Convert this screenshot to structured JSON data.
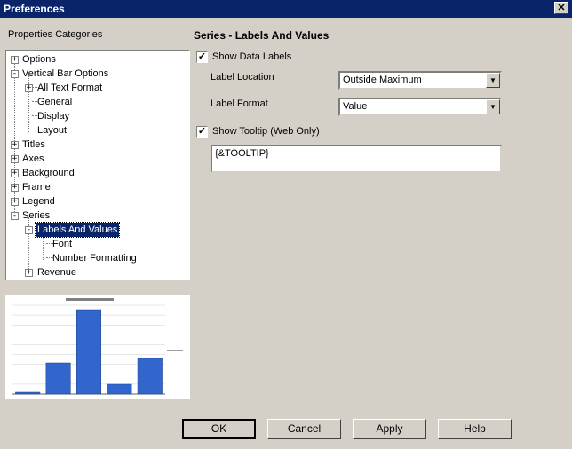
{
  "window": {
    "title": "Preferences",
    "close_glyph": "✕"
  },
  "left": {
    "heading": "Properties Categories",
    "tree": [
      {
        "label": "Options",
        "sign": "+"
      },
      {
        "label": "Vertical Bar Options",
        "sign": "-"
      },
      {
        "label": "All Text Format",
        "sign": "+"
      },
      {
        "label": "General"
      },
      {
        "label": "Display"
      },
      {
        "label": "Layout"
      },
      {
        "label": "Titles",
        "sign": "+"
      },
      {
        "label": "Axes",
        "sign": "+"
      },
      {
        "label": "Background",
        "sign": "+"
      },
      {
        "label": "Frame",
        "sign": "+"
      },
      {
        "label": "Legend",
        "sign": "+"
      },
      {
        "label": "Series",
        "sign": "-"
      },
      {
        "label": "Labels And Values",
        "sign": "-",
        "selected": true
      },
      {
        "label": "Font"
      },
      {
        "label": "Number Formatting"
      },
      {
        "label": "Revenue",
        "sign": "+"
      }
    ]
  },
  "right": {
    "heading": "Series - Labels And Values",
    "show_data_labels": {
      "label": "Show Data Labels",
      "checked": true
    },
    "label_location": {
      "label": "Label Location",
      "value": "Outside Maximum"
    },
    "label_format": {
      "label": "Label Format",
      "value": "Value"
    },
    "show_tooltip": {
      "label": "Show Tooltip (Web Only)",
      "checked": true
    },
    "tooltip_text": "{&TOOLTIP}"
  },
  "preview_chart": {
    "type": "bar",
    "values": [
      2,
      35,
      95,
      11,
      40
    ],
    "ylim": [
      0,
      100
    ],
    "bar_color": "#3366cc"
  },
  "buttons": {
    "ok": "OK",
    "cancel": "Cancel",
    "apply": "Apply",
    "help": "Help"
  },
  "colors": {
    "titlebar": "#0a246a",
    "dialog": "#d4d0c8",
    "selection": "#0a246a"
  }
}
